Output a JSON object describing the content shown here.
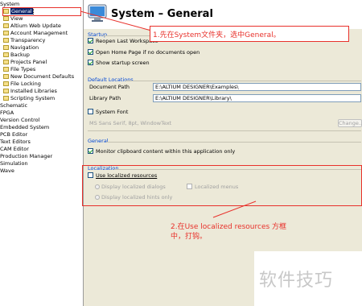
{
  "tree": {
    "root": "System",
    "children": [
      "General",
      "View",
      "Altium Web Update",
      "Account Management",
      "Transparency",
      "Navigation",
      "Backup",
      "Projects Panel",
      "File Types",
      "New Document Defaults",
      "File Locking",
      "Installed Libraries",
      "Scripting System"
    ],
    "top_level": [
      "Schematic",
      "FPGA",
      "Version Control",
      "Embedded System",
      "PCB Editor",
      "Text Editors",
      "CAM Editor",
      "Production Manager",
      "Simulation",
      "Wave"
    ]
  },
  "header": {
    "title": "System – General",
    "icon": "monitor-icon"
  },
  "startup": {
    "label": "Startup",
    "reopen": "Reopen Last Workspace",
    "open_home": "Open Home Page if no documents open",
    "show_splash": "Show startup screen"
  },
  "default_locations": {
    "label": "Default Locations",
    "doc_label": "Document Path",
    "doc_value": "E:\\ALTIUM DESIGNER\\Examples\\",
    "lib_label": "Library Path",
    "lib_value": "E:\\ALTIUM DESIGNER\\Library\\"
  },
  "system_font": {
    "label": "System Font",
    "sample": "MS Sans Serif, 8pt, WindowText",
    "change_button": "Change..."
  },
  "general": {
    "label": "General",
    "monitor": "Monitor clipboard content within this application only"
  },
  "localization": {
    "label": "Localization",
    "use_localized": "Use localized resources",
    "dialogs": "Display localized dialogs",
    "menus": "Localized menus",
    "hints": "Display localized hints only"
  },
  "annotations": {
    "step1": "1.先在System文件夹，选中General。",
    "step2_line1": "2.在Use localized resources 方框",
    "step2_line2": "中，打钩。"
  },
  "watermark": "软件技巧",
  "colors": {
    "accent": "#0a246a",
    "annotation": "#e8312b",
    "section": "#0046d5"
  }
}
